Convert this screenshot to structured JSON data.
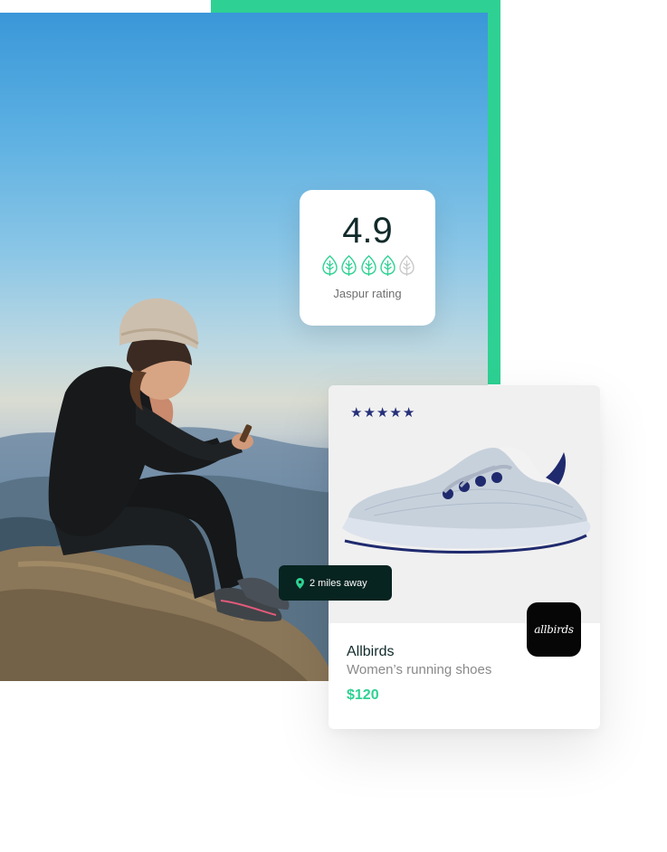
{
  "rating": {
    "value": "4.9",
    "label": "Jaspur rating",
    "leaves": [
      {
        "icon": "leaf-icon",
        "state": "filled"
      },
      {
        "icon": "leaf-icon",
        "state": "filled"
      },
      {
        "icon": "leaf-icon",
        "state": "filled"
      },
      {
        "icon": "leaf-icon",
        "state": "filled"
      },
      {
        "icon": "leaf-icon",
        "state": "empty"
      }
    ]
  },
  "product": {
    "stars": 5,
    "brand_logo": "allbirds",
    "name": "Allbirds",
    "description": "Women’s running shoes",
    "price": "$120"
  },
  "distance": {
    "icon": "location-pin-icon",
    "text": "2 miles away"
  },
  "colors": {
    "accent_green": "#2ed193",
    "dark_green": "#072420",
    "star_navy": "#26307a",
    "text_dark": "#112a2a"
  }
}
